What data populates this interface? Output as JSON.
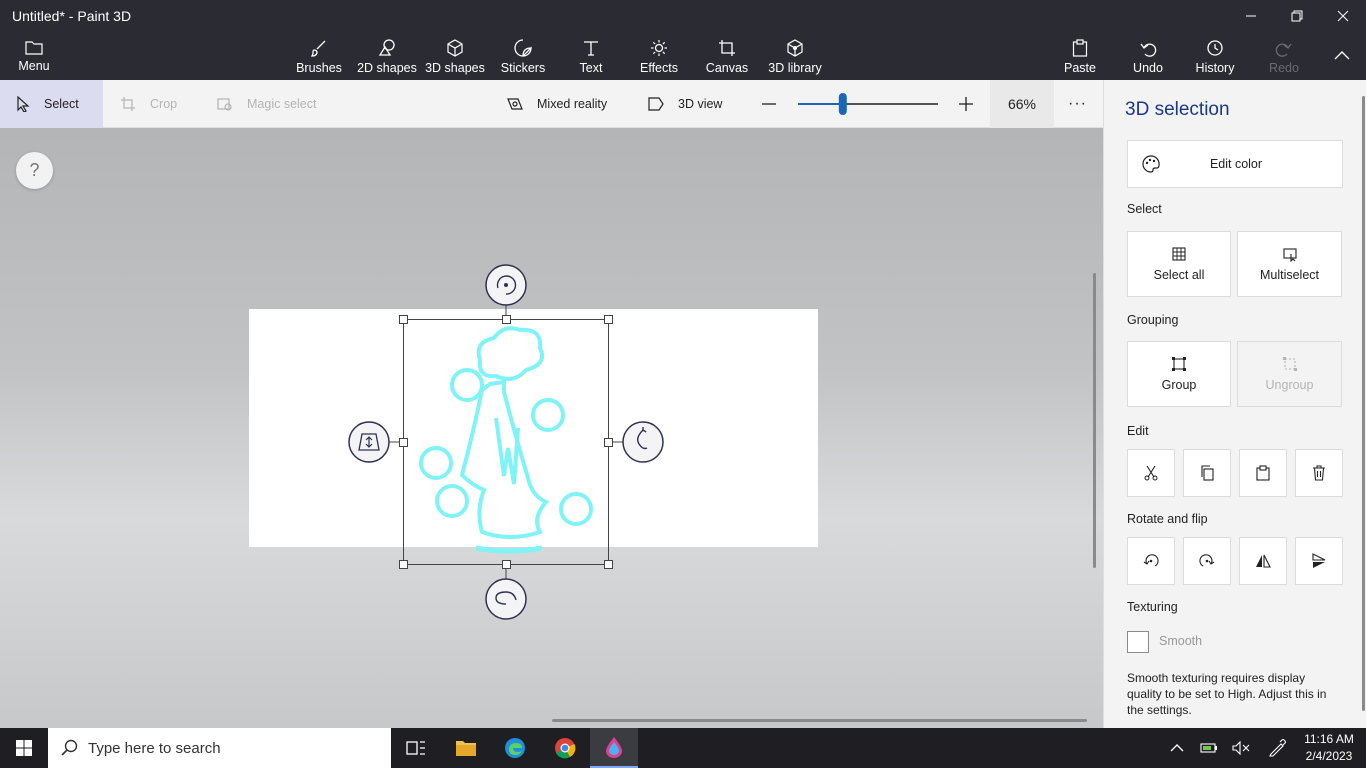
{
  "window": {
    "title": "Untitled* - Paint 3D",
    "controls": [
      "minimize-icon",
      "restore-icon",
      "close-icon"
    ]
  },
  "ribbon": {
    "menu_label": "Menu",
    "tools": [
      {
        "label": "Brushes",
        "icon": "brush-icon"
      },
      {
        "label": "2D shapes",
        "icon": "2d-shapes-icon"
      },
      {
        "label": "3D shapes",
        "icon": "3d-shapes-icon"
      },
      {
        "label": "Stickers",
        "icon": "stickers-icon"
      },
      {
        "label": "Text",
        "icon": "text-icon"
      },
      {
        "label": "Effects",
        "icon": "effects-icon"
      },
      {
        "label": "Canvas",
        "icon": "canvas-icon"
      },
      {
        "label": "3D library",
        "icon": "3d-library-icon"
      }
    ],
    "paste_label": "Paste",
    "undo_label": "Undo",
    "history_label": "History",
    "redo_label": "Redo"
  },
  "toolbar": {
    "select_label": "Select",
    "crop_label": "Crop",
    "magic_select_label": "Magic select",
    "mixed_reality_label": "Mixed reality",
    "view_3d_label": "3D view",
    "zoom_value": "66%",
    "zoom_fraction": 0.32,
    "more_label": "···"
  },
  "canvas": {
    "help_label": "?"
  },
  "panel": {
    "title": "3D selection",
    "edit_color_label": "Edit color",
    "select_heading": "Select",
    "select_all_label": "Select all",
    "multiselect_label": "Multiselect",
    "grouping_heading": "Grouping",
    "group_label": "Group",
    "ungroup_label": "Ungroup",
    "edit_heading": "Edit",
    "edit_actions": [
      "cut-icon",
      "copy-icon",
      "paste-icon",
      "delete-icon"
    ],
    "rotate_heading": "Rotate and flip",
    "rotate_actions": [
      "rotate-left-icon",
      "rotate-right-icon",
      "flip-horizontal-icon",
      "flip-vertical-icon"
    ],
    "texturing_heading": "Texturing",
    "smooth_label": "Smooth",
    "smooth_checked": false,
    "smooth_note": "Smooth texturing requires display quality to be set to High. Adjust this in the settings."
  },
  "taskbar": {
    "search_placeholder": "Type here to search",
    "time": "11:16 AM",
    "date": "2/4/2023"
  },
  "colors": {
    "chrome_dark": "#2b2c33",
    "panel_title": "#1a3a86",
    "sketch": "#7ff3f5",
    "selection_active": "#dcdcf0"
  }
}
